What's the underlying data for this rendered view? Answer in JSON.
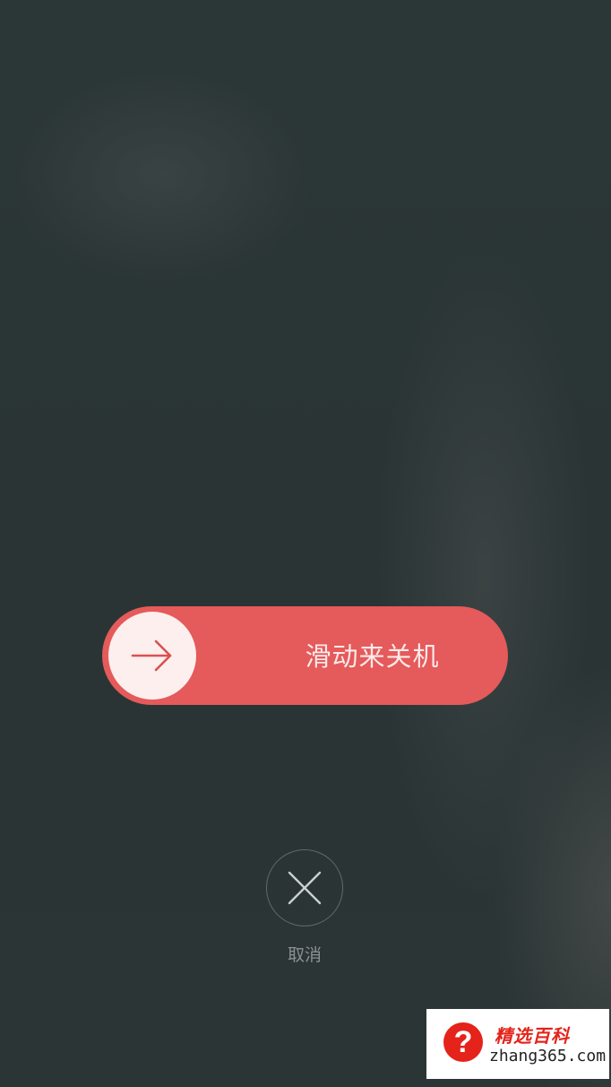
{
  "power_menu": {
    "slider_label": "滑动来关机",
    "slider_color": "#e55a5a",
    "slider_icon": "arrow-right-icon",
    "cancel_icon": "close-icon",
    "cancel_label": "取消"
  },
  "watermark": {
    "icon": "question-mark-icon",
    "icon_glyph": "?",
    "title": "精选百科",
    "url": "zhang365.com"
  }
}
